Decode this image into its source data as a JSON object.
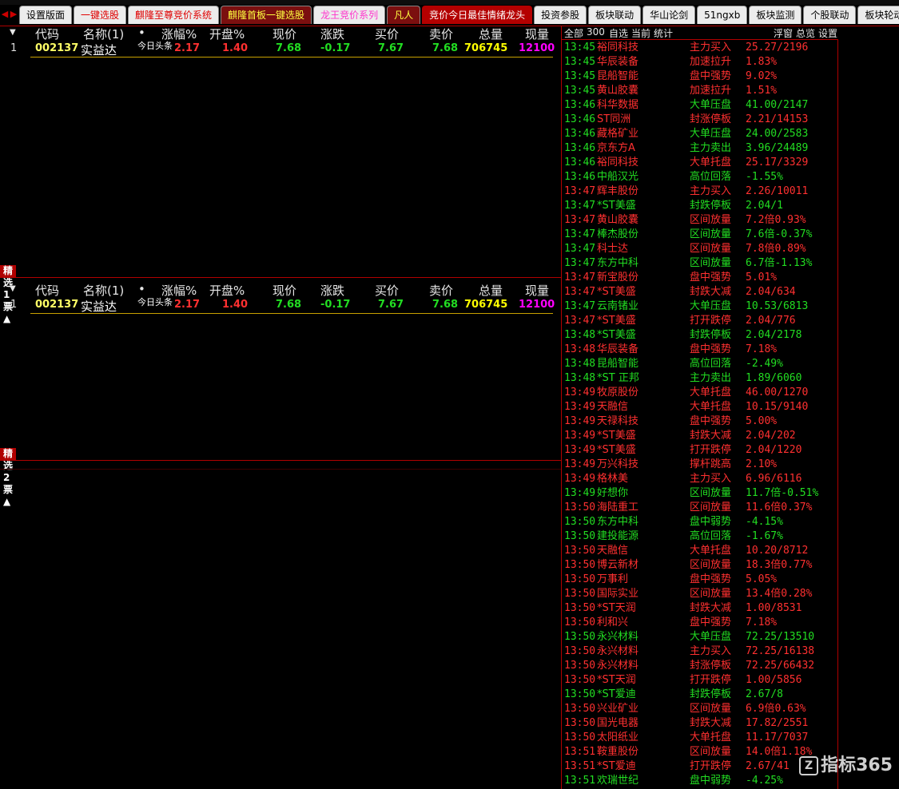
{
  "tabbar": {
    "nav_left": "◀",
    "nav_right": "▶",
    "tabs": [
      {
        "label": "设置版面",
        "style": "normal"
      },
      {
        "label": "一键选股",
        "style": "red"
      },
      {
        "label": "麒隆至尊竞价系统",
        "style": "red"
      },
      {
        "label": "麒隆首板一键选股",
        "style": "yellow"
      },
      {
        "label": "龙王竞价系列",
        "style": "pink"
      },
      {
        "label": "凡人",
        "style": "yellow"
      },
      {
        "label": "竞价今日最佳情绪龙头",
        "style": "active"
      },
      {
        "label": "投资参股",
        "style": "normal"
      },
      {
        "label": "板块联动",
        "style": "normal"
      },
      {
        "label": "华山论剑",
        "style": "normal"
      },
      {
        "label": "51ngxb",
        "style": "normal"
      },
      {
        "label": "板块监测",
        "style": "normal"
      },
      {
        "label": "个股联动",
        "style": "normal"
      },
      {
        "label": "板块轮动",
        "style": "normal"
      }
    ]
  },
  "columns": {
    "arrow": "▼",
    "code": "代码",
    "name": "名称(1)",
    "dot": "•",
    "change_pct": "涨幅%",
    "open_pct": "开盘%",
    "price": "现价",
    "change": "涨跌",
    "bid": "买价",
    "ask": "卖价",
    "volume": "总量",
    "last_vol": "现量"
  },
  "grid1": {
    "row": {
      "index": "1",
      "code": "002137",
      "name": "实益达",
      "note": "今日头条",
      "change_pct": "2.17",
      "open_pct": "1.40",
      "price": "7.68",
      "change": "-0.17",
      "bid": "7.67",
      "ask": "7.68",
      "volume": "706745",
      "last_vol": "12100"
    }
  },
  "section1": {
    "label": "精选1票▲"
  },
  "grid2": {
    "row": {
      "index": "1",
      "code": "002137",
      "name": "实益达",
      "note": "今日头条",
      "change_pct": "2.17",
      "open_pct": "1.40",
      "price": "7.68",
      "change": "-0.17",
      "bid": "7.67",
      "ask": "7.68",
      "volume": "706745",
      "last_vol": "12100"
    }
  },
  "section2": {
    "label": "精选2票▲"
  },
  "monitor": {
    "toolbar": {
      "all": "全部",
      "count": "300",
      "self": "自选",
      "current": "当前",
      "stats": "统计",
      "float": "浮窗",
      "overview": "总览",
      "settings": "设置"
    },
    "events": [
      {
        "time": "13:45",
        "name": "裕同科技",
        "kind": "主力买入",
        "value": "25.27/2196",
        "tc": "g",
        "nc": "r",
        "kc": "r",
        "vc": "r"
      },
      {
        "time": "13:45",
        "name": "华辰装备",
        "kind": "加速拉升",
        "value": "1.83%",
        "tc": "g",
        "nc": "r",
        "kc": "r",
        "vc": "r"
      },
      {
        "time": "13:45",
        "name": "昆船智能",
        "kind": "盘中强势",
        "value": "9.02%",
        "tc": "g",
        "nc": "r",
        "kc": "r",
        "vc": "r"
      },
      {
        "time": "13:45",
        "name": "黄山胶囊",
        "kind": "加速拉升",
        "value": "1.51%",
        "tc": "g",
        "nc": "r",
        "kc": "r",
        "vc": "r"
      },
      {
        "time": "13:46",
        "name": "科华数据",
        "kind": "大单压盘",
        "value": "41.00/2147",
        "tc": "g",
        "nc": "r",
        "kc": "g",
        "vc": "g"
      },
      {
        "time": "13:46",
        "name": "ST同洲",
        "kind": "封涨停板",
        "value": "2.21/14153",
        "tc": "g",
        "nc": "r",
        "kc": "r",
        "vc": "r"
      },
      {
        "time": "13:46",
        "name": "藏格矿业",
        "kind": "大单压盘",
        "value": "24.00/2583",
        "tc": "g",
        "nc": "r",
        "kc": "g",
        "vc": "g"
      },
      {
        "time": "13:46",
        "name": "京东方A",
        "kind": "主力卖出",
        "value": "3.96/24489",
        "tc": "g",
        "nc": "r",
        "kc": "g",
        "vc": "g"
      },
      {
        "time": "13:46",
        "name": "裕同科技",
        "kind": "大单托盘",
        "value": "25.17/3329",
        "tc": "g",
        "nc": "r",
        "kc": "r",
        "vc": "r"
      },
      {
        "time": "13:46",
        "name": "中船汉光",
        "kind": "高位回落",
        "value": "-1.55%",
        "tc": "g",
        "nc": "g",
        "kc": "g",
        "vc": "g"
      },
      {
        "time": "13:47",
        "name": "辉丰股份",
        "kind": "主力买入",
        "value": "2.26/10011",
        "tc": "r",
        "nc": "r",
        "kc": "r",
        "vc": "r"
      },
      {
        "time": "13:47",
        "name": "*ST美盛",
        "kind": "封跌停板",
        "value": "2.04/1",
        "tc": "g",
        "nc": "g",
        "kc": "g",
        "vc": "g"
      },
      {
        "time": "13:47",
        "name": "黄山胶囊",
        "kind": "区间放量",
        "value": "7.2倍0.93%",
        "tc": "r",
        "nc": "r",
        "kc": "r",
        "vc": "r"
      },
      {
        "time": "13:47",
        "name": "棒杰股份",
        "kind": "区间放量",
        "value": "7.6倍-0.37%",
        "tc": "g",
        "nc": "g",
        "kc": "g",
        "vc": "g"
      },
      {
        "time": "13:47",
        "name": "科士达",
        "kind": "区间放量",
        "value": "7.8倍0.89%",
        "tc": "g",
        "nc": "r",
        "kc": "r",
        "vc": "r"
      },
      {
        "time": "13:47",
        "name": "东方中科",
        "kind": "区间放量",
        "value": "6.7倍-1.13%",
        "tc": "g",
        "nc": "g",
        "kc": "g",
        "vc": "g"
      },
      {
        "time": "13:47",
        "name": "新宝股份",
        "kind": "盘中强势",
        "value": "5.01%",
        "tc": "r",
        "nc": "r",
        "kc": "r",
        "vc": "r"
      },
      {
        "time": "13:47",
        "name": "*ST美盛",
        "kind": "封跌大减",
        "value": "2.04/634",
        "tc": "r",
        "nc": "r",
        "kc": "r",
        "vc": "r"
      },
      {
        "time": "13:47",
        "name": "云南锗业",
        "kind": "大单压盘",
        "value": "10.53/6813",
        "tc": "g",
        "nc": "g",
        "kc": "g",
        "vc": "g"
      },
      {
        "time": "13:47",
        "name": "*ST美盛",
        "kind": "打开跌停",
        "value": "2.04/776",
        "tc": "r",
        "nc": "r",
        "kc": "r",
        "vc": "r"
      },
      {
        "time": "13:48",
        "name": "*ST美盛",
        "kind": "封跌停板",
        "value": "2.04/2178",
        "tc": "g",
        "nc": "g",
        "kc": "g",
        "vc": "g"
      },
      {
        "time": "13:48",
        "name": "华辰装备",
        "kind": "盘中强势",
        "value": "7.18%",
        "tc": "r",
        "nc": "r",
        "kc": "r",
        "vc": "r"
      },
      {
        "time": "13:48",
        "name": "昆船智能",
        "kind": "高位回落",
        "value": "-2.49%",
        "tc": "g",
        "nc": "g",
        "kc": "g",
        "vc": "g"
      },
      {
        "time": "13:48",
        "name": "*ST 正邦",
        "kind": "主力卖出",
        "value": "1.89/6060",
        "tc": "g",
        "nc": "g",
        "kc": "g",
        "vc": "g"
      },
      {
        "time": "13:49",
        "name": "牧原股份",
        "kind": "大单托盘",
        "value": "46.00/1270",
        "tc": "r",
        "nc": "r",
        "kc": "r",
        "vc": "r"
      },
      {
        "time": "13:49",
        "name": "天融信",
        "kind": "大单托盘",
        "value": "10.15/9140",
        "tc": "r",
        "nc": "r",
        "kc": "r",
        "vc": "r"
      },
      {
        "time": "13:49",
        "name": "天禄科技",
        "kind": "盘中强势",
        "value": "5.00%",
        "tc": "r",
        "nc": "r",
        "kc": "r",
        "vc": "r"
      },
      {
        "time": "13:49",
        "name": "*ST美盛",
        "kind": "封跌大减",
        "value": "2.04/202",
        "tc": "r",
        "nc": "r",
        "kc": "r",
        "vc": "r"
      },
      {
        "time": "13:49",
        "name": "*ST美盛",
        "kind": "打开跌停",
        "value": "2.04/1220",
        "tc": "r",
        "nc": "r",
        "kc": "r",
        "vc": "r"
      },
      {
        "time": "13:49",
        "name": "万兴科技",
        "kind": "撑杆跳高",
        "value": "2.10%",
        "tc": "r",
        "nc": "r",
        "kc": "r",
        "vc": "r"
      },
      {
        "time": "13:49",
        "name": "格林美",
        "kind": "主力买入",
        "value": "6.96/6116",
        "tc": "r",
        "nc": "r",
        "kc": "r",
        "vc": "r"
      },
      {
        "time": "13:49",
        "name": "好想你",
        "kind": "区间放量",
        "value": "11.7倍-0.51%",
        "tc": "g",
        "nc": "g",
        "kc": "g",
        "vc": "g"
      },
      {
        "time": "13:50",
        "name": "海陆重工",
        "kind": "区间放量",
        "value": "11.6倍0.37%",
        "tc": "r",
        "nc": "r",
        "kc": "r",
        "vc": "r"
      },
      {
        "time": "13:50",
        "name": "东方中科",
        "kind": "盘中弱势",
        "value": "-4.15%",
        "tc": "g",
        "nc": "g",
        "kc": "g",
        "vc": "g"
      },
      {
        "time": "13:50",
        "name": "建投能源",
        "kind": "高位回落",
        "value": "-1.67%",
        "tc": "g",
        "nc": "g",
        "kc": "g",
        "vc": "g"
      },
      {
        "time": "13:50",
        "name": "天融信",
        "kind": "大单托盘",
        "value": "10.20/8712",
        "tc": "r",
        "nc": "r",
        "kc": "r",
        "vc": "r"
      },
      {
        "time": "13:50",
        "name": "博云新材",
        "kind": "区间放量",
        "value": "18.3倍0.77%",
        "tc": "r",
        "nc": "r",
        "kc": "r",
        "vc": "r"
      },
      {
        "time": "13:50",
        "name": "万事利",
        "kind": "盘中强势",
        "value": "5.05%",
        "tc": "r",
        "nc": "r",
        "kc": "r",
        "vc": "r"
      },
      {
        "time": "13:50",
        "name": "国际实业",
        "kind": "区间放量",
        "value": "13.4倍0.28%",
        "tc": "r",
        "nc": "r",
        "kc": "r",
        "vc": "r"
      },
      {
        "time": "13:50",
        "name": "*ST天润",
        "kind": "封跌大减",
        "value": "1.00/8531",
        "tc": "r",
        "nc": "r",
        "kc": "r",
        "vc": "r"
      },
      {
        "time": "13:50",
        "name": "利和兴",
        "kind": "盘中强势",
        "value": "7.18%",
        "tc": "r",
        "nc": "r",
        "kc": "r",
        "vc": "r"
      },
      {
        "time": "13:50",
        "name": "永兴材料",
        "kind": "大单压盘",
        "value": "72.25/13510",
        "tc": "g",
        "nc": "g",
        "kc": "g",
        "vc": "g"
      },
      {
        "time": "13:50",
        "name": "永兴材料",
        "kind": "主力买入",
        "value": "72.25/16138",
        "tc": "r",
        "nc": "r",
        "kc": "r",
        "vc": "r"
      },
      {
        "time": "13:50",
        "name": "永兴材料",
        "kind": "封涨停板",
        "value": "72.25/66432",
        "tc": "r",
        "nc": "r",
        "kc": "r",
        "vc": "r"
      },
      {
        "time": "13:50",
        "name": "*ST天润",
        "kind": "打开跌停",
        "value": "1.00/5856",
        "tc": "r",
        "nc": "r",
        "kc": "r",
        "vc": "r"
      },
      {
        "time": "13:50",
        "name": "*ST爱迪",
        "kind": "封跌停板",
        "value": "2.67/8",
        "tc": "g",
        "nc": "g",
        "kc": "g",
        "vc": "g"
      },
      {
        "time": "13:50",
        "name": "兴业矿业",
        "kind": "区间放量",
        "value": "6.9倍0.63%",
        "tc": "r",
        "nc": "r",
        "kc": "r",
        "vc": "r"
      },
      {
        "time": "13:50",
        "name": "国光电器",
        "kind": "封跌大减",
        "value": "17.82/2551",
        "tc": "r",
        "nc": "r",
        "kc": "r",
        "vc": "r"
      },
      {
        "time": "13:50",
        "name": "太阳纸业",
        "kind": "大单托盘",
        "value": "11.17/7037",
        "tc": "r",
        "nc": "r",
        "kc": "r",
        "vc": "r"
      },
      {
        "time": "13:51",
        "name": "鞍重股份",
        "kind": "区间放量",
        "value": "14.0倍1.18%",
        "tc": "r",
        "nc": "r",
        "kc": "r",
        "vc": "r"
      },
      {
        "time": "13:51",
        "name": "*ST爱迪",
        "kind": "打开跌停",
        "value": "2.67/41",
        "tc": "r",
        "nc": "r",
        "kc": "r",
        "vc": "r"
      },
      {
        "time": "13:51",
        "name": "欢瑞世纪",
        "kind": "盘中弱势",
        "value": "-4.25%",
        "tc": "g",
        "nc": "g",
        "kc": "g",
        "vc": "g"
      }
    ]
  },
  "colors": {
    "red": "#ff3030",
    "green": "#22dd22",
    "yellow": "#ffff00",
    "magenta": "#ff00ff",
    "accent": "#b00000"
  },
  "watermark": {
    "logo": "Z",
    "text": "指标365"
  }
}
